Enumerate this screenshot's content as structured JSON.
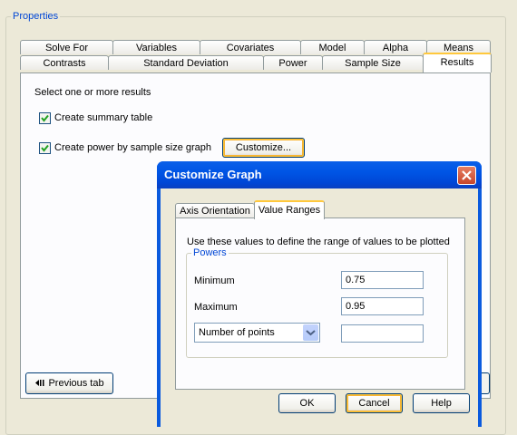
{
  "properties": {
    "group_title": "Properties",
    "tabs_row1": [
      "Solve For",
      "Variables",
      "Covariates",
      "Model",
      "Alpha",
      "Means"
    ],
    "tabs_row2": [
      "Contrasts",
      "Standard Deviation",
      "Power",
      "Sample Size",
      "Results"
    ],
    "selected_tab": "Results",
    "results": {
      "instruction": "Select one or more results",
      "summary_table_label": "Create summary table",
      "summary_table_checked": true,
      "power_graph_label": "Create power by sample size graph",
      "power_graph_checked": true,
      "customize_button": "Customize..."
    },
    "previous_tab_button": "Previous tab"
  },
  "dialog": {
    "title": "Customize Graph",
    "tabs": [
      "Axis Orientation",
      "Value Ranges"
    ],
    "selected_tab": "Value Ranges",
    "instruction": "Use these values to define the range of values to be plotted",
    "powers": {
      "legend": "Powers",
      "minimum_label": "Minimum",
      "minimum_value": "0.75",
      "maximum_label": "Maximum",
      "maximum_value": "0.95",
      "points_select": "Number of points",
      "points_value": ""
    },
    "buttons": {
      "ok": "OK",
      "cancel": "Cancel",
      "help": "Help"
    }
  }
}
